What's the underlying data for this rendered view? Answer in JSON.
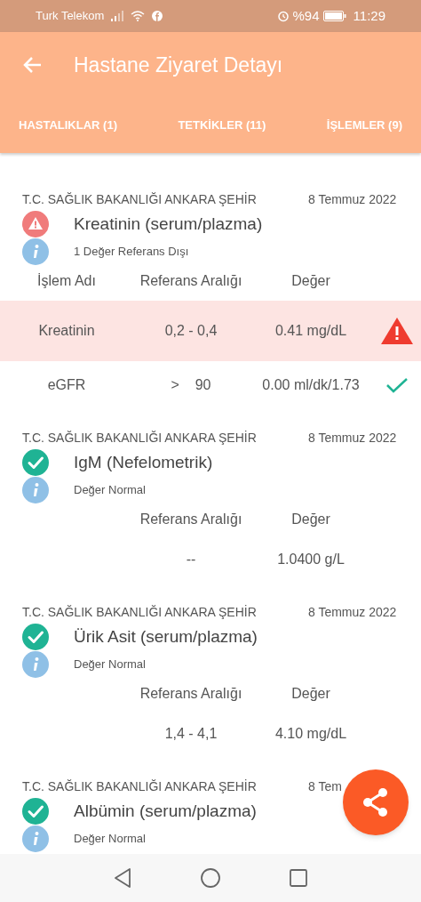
{
  "status_bar": {
    "carrier": "Turk Telekom",
    "battery": "%94",
    "time": "11:29"
  },
  "app_bar": {
    "title": "Hastane Ziyaret Detayı"
  },
  "tabs": [
    {
      "label": "HASTALIKLAR (1)"
    },
    {
      "label": "TETKİKLER (11)"
    },
    {
      "label": "İŞLEMLER (9)"
    }
  ],
  "cards": [
    {
      "hospital": "T.C. SAĞLIK BAKANLIĞI ANKARA ŞEHİR",
      "date": "8 Temmuz 2022",
      "abnormal": true,
      "title": "Kreatinin (serum/plazma)",
      "info": "1 Değer Referans Dışı",
      "header": {
        "name": "İşlem Adı",
        "range": "Referans Aralığı",
        "value": "Değer"
      },
      "rows": [
        {
          "name": "Kreatinin",
          "range": "0,2 - 0,4",
          "value": "0.41 mg/dL",
          "out_of_range": true
        },
        {
          "name": "eGFR",
          "range": ">    90",
          "value": "0.00 ml/dk/1.73",
          "out_of_range": false
        }
      ]
    },
    {
      "hospital": "T.C. SAĞLIK BAKANLIĞI ANKARA ŞEHİR",
      "date": "8 Temmuz 2022",
      "abnormal": false,
      "title": "IgM (Nefelometrik)",
      "info": "Değer Normal",
      "header": {
        "range": "Referans Aralığı",
        "value": "Değer"
      },
      "rows": [
        {
          "range": "--",
          "value": "1.0400 g/L"
        }
      ]
    },
    {
      "hospital": "T.C. SAĞLIK BAKANLIĞI ANKARA ŞEHİR",
      "date": "8 Temmuz 2022",
      "abnormal": false,
      "title": "Ürik Asit (serum/plazma)",
      "info": "Değer Normal",
      "header": {
        "range": "Referans Aralığı",
        "value": "Değer"
      },
      "rows": [
        {
          "range": "1,4 - 4,1",
          "value": "4.10 mg/dL"
        }
      ]
    },
    {
      "hospital": "T.C. SAĞLIK BAKANLIĞI ANKARA ŞEHİR",
      "date": "8 Tem",
      "abnormal": false,
      "title": "Albümin (serum/plazma)",
      "info": "Değer Normal"
    }
  ]
}
